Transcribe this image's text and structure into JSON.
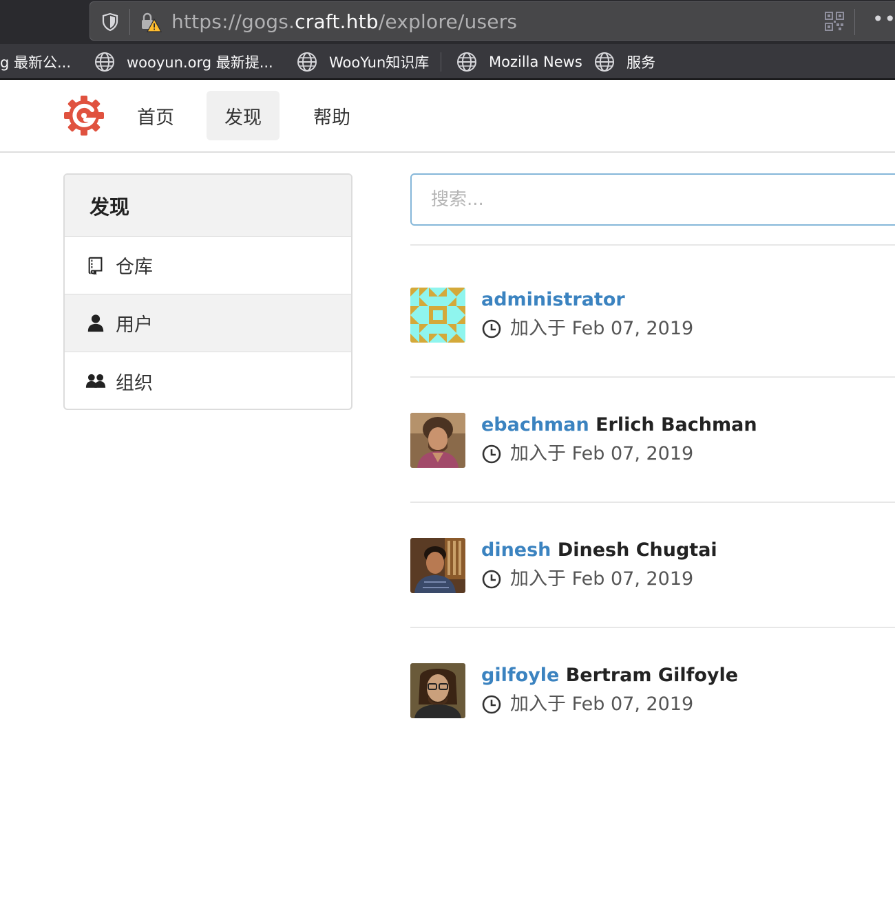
{
  "browser": {
    "url_prefix": "https://gogs.",
    "url_host": "craft.htb",
    "url_path": "/explore/users",
    "more_label": "•••"
  },
  "bookmarks": [
    {
      "label": "g 最新公..."
    },
    {
      "label": "wooyun.org 最新提..."
    },
    {
      "label": "WooYun知识库"
    },
    {
      "label": "Mozilla News"
    },
    {
      "label": "服务"
    }
  ],
  "header": {
    "nav": [
      {
        "label": "首页"
      },
      {
        "label": "发现"
      },
      {
        "label": "帮助"
      }
    ]
  },
  "sidebar": {
    "title": "发现",
    "items": [
      {
        "label": "仓库",
        "icon": "repo-icon"
      },
      {
        "label": "用户",
        "icon": "person-icon"
      },
      {
        "label": "组织",
        "icon": "organization-icon"
      }
    ]
  },
  "search": {
    "placeholder": "搜索..."
  },
  "users": [
    {
      "username": "administrator",
      "full_name": "",
      "joined": "加入于 Feb 07, 2019"
    },
    {
      "username": "ebachman",
      "full_name": "Erlich Bachman",
      "joined": "加入于 Feb 07, 2019"
    },
    {
      "username": "dinesh",
      "full_name": "Dinesh Chugtai",
      "joined": "加入于 Feb 07, 2019"
    },
    {
      "username": "gilfoyle",
      "full_name": "Bertram Gilfoyle",
      "joined": "加入于 Feb 07, 2019"
    }
  ],
  "colors": {
    "link": "#3b83c0",
    "identicon_bg": "#8ff5ee",
    "identicon_fg": "#d4a93a",
    "logo": "#e0523f"
  }
}
